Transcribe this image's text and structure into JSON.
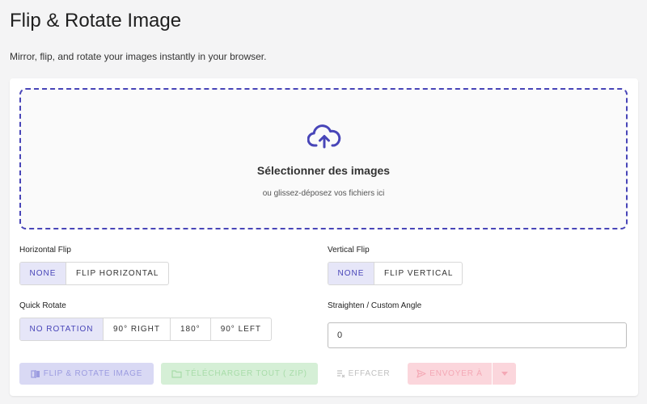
{
  "header": {
    "title": "Flip & Rotate Image",
    "subtitle": "Mirror, flip, and rotate your images instantly in your browser."
  },
  "dropzone": {
    "icon": "cloud-upload-icon",
    "title": "Sélectionner des images",
    "subtitle": "ou glissez-déposez vos fichiers ici"
  },
  "horizontal_flip": {
    "label": "Horizontal Flip",
    "options": [
      "NONE",
      "FLIP HORIZONTAL"
    ],
    "selected": "NONE"
  },
  "vertical_flip": {
    "label": "Vertical Flip",
    "options": [
      "NONE",
      "FLIP VERTICAL"
    ],
    "selected": "NONE"
  },
  "quick_rotate": {
    "label": "Quick Rotate",
    "options": [
      "NO ROTATION",
      "90° RIGHT",
      "180°",
      "90° LEFT"
    ],
    "selected": "NO ROTATION"
  },
  "custom_angle": {
    "label": "Straighten / Custom Angle",
    "value": "0"
  },
  "actions": {
    "flip_rotate": "FLIP & ROTATE IMAGE",
    "download_zip": "TÉLÉCHARGER TOUT ( ZIP)",
    "clear": "EFFACER",
    "send_to": "ENVOYER À",
    "send_dropdown_icon": "caret-down-icon"
  },
  "colors": {
    "accent": "#4845b8",
    "success": "#4caf50",
    "danger": "#f06292"
  }
}
